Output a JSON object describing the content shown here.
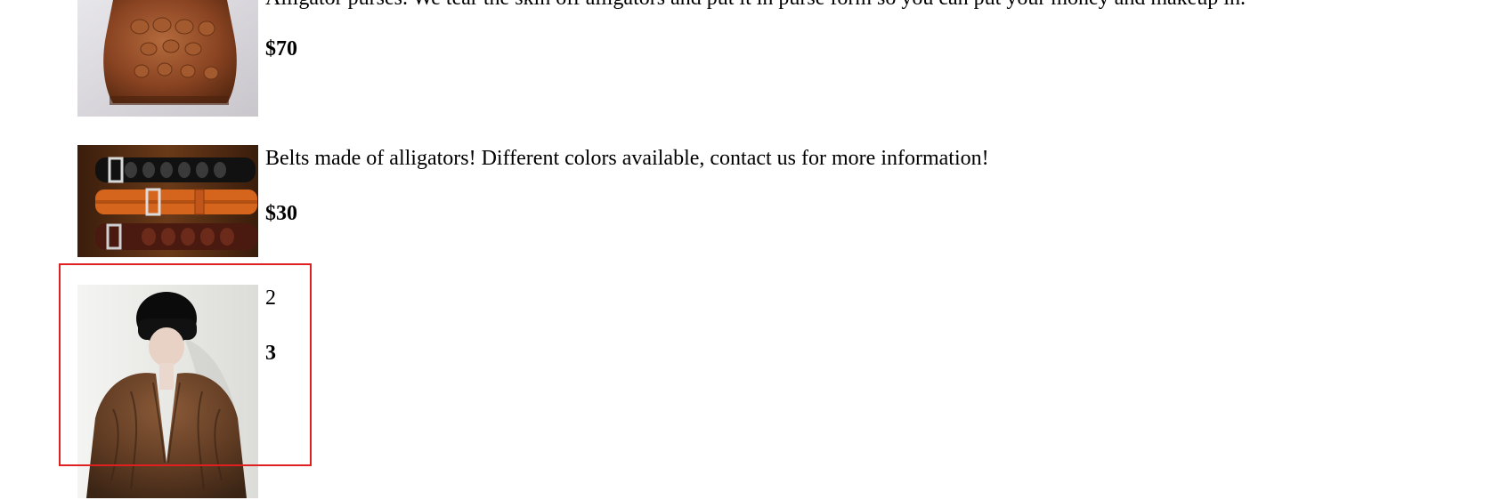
{
  "products": [
    {
      "image": "alligator-purse-photo",
      "description": "Alligator purses. We tear the skin off alligators and put it in purse form so you can put your money and makeup in.",
      "price": "$70"
    },
    {
      "image": "alligator-belts-photo",
      "description": "Belts made of alligators! Different colors available, contact us for more information!",
      "price": "$30"
    },
    {
      "image": "fur-coat-mannequin-photo",
      "description": "2",
      "price": "3"
    }
  ],
  "highlight_color": "#e02020"
}
